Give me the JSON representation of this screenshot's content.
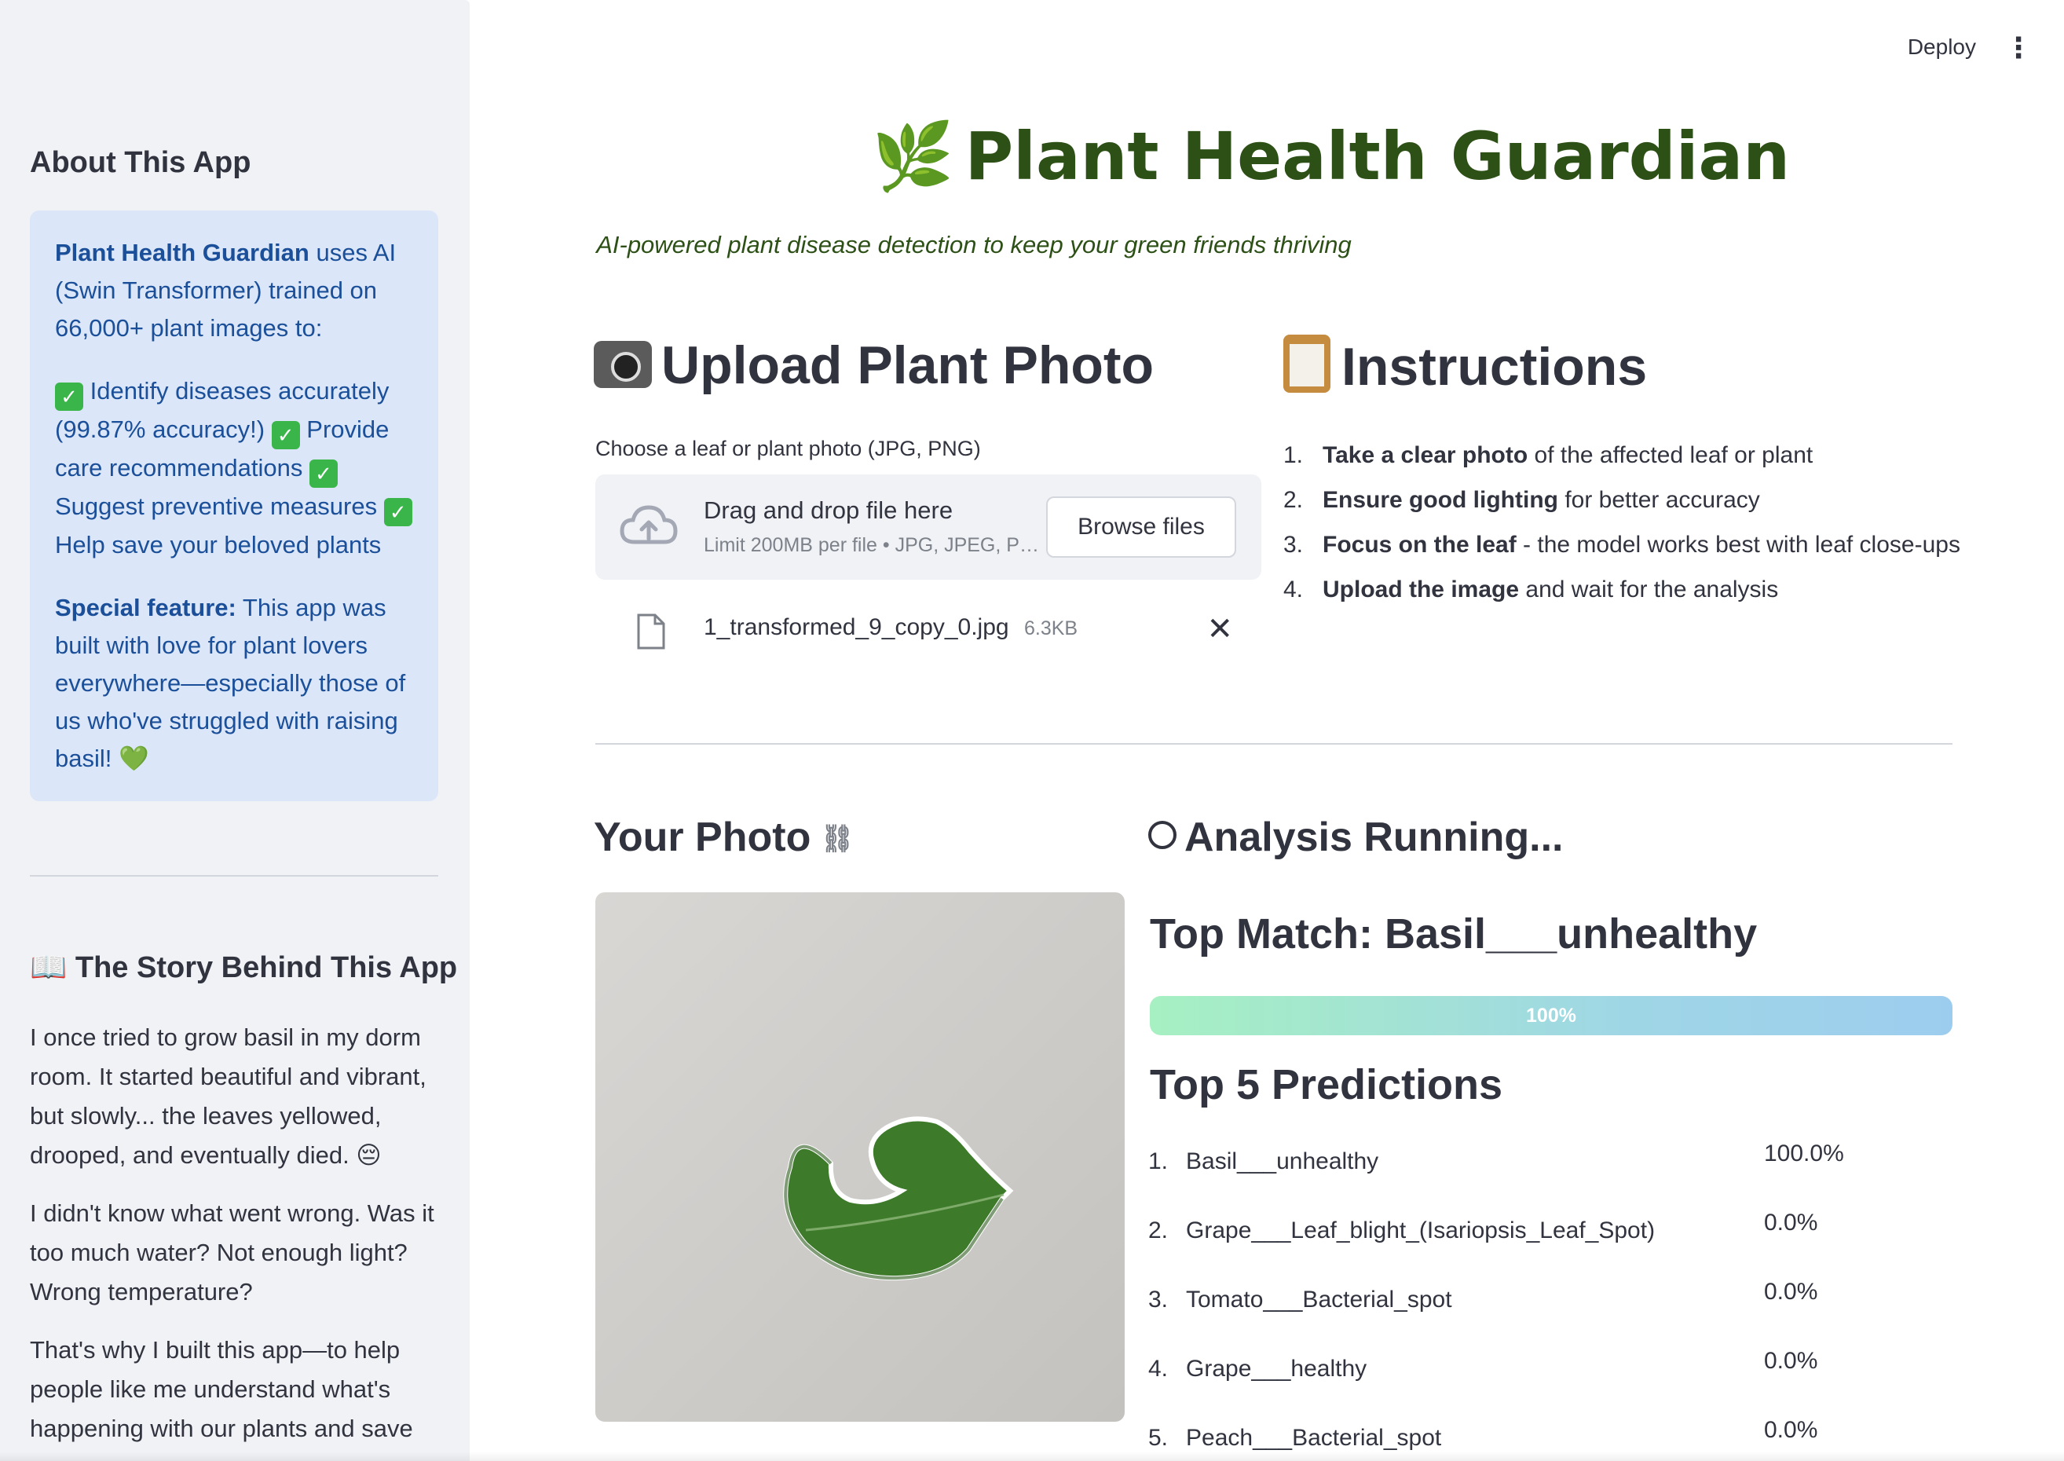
{
  "header": {
    "deploy_label": "Deploy",
    "menu_icon": "⋮"
  },
  "sidebar": {
    "about_heading": "About This App",
    "info": {
      "intro_bold": "Plant Health Guardian",
      "intro_rest": " uses AI (Swin Transformer) trained on 66,000+ plant images to:",
      "features_text_1": " Identify diseases accurately (99.87% accuracy!) ",
      "features_text_2": " Provide care recommendations ",
      "features_text_3": " Suggest preventive measures ",
      "features_text_4": " Help save your beloved plants",
      "special_bold": "Special feature:",
      "special_rest": " This app was built with love for plant lovers everywhere—especially those of us who've struggled with raising basil! 💚"
    },
    "story_heading": "📖 The Story Behind This App",
    "story_paragraphs": [
      "I once tried to grow basil in my dorm room. It started beautiful and vibrant, but slowly... the leaves yellowed, drooped, and eventually died. 😔",
      "I didn't know what went wrong. Was it too much water? Not enough light? Wrong temperature?",
      "That's why I built this app—to help people like me understand what's happening with our plants and save"
    ]
  },
  "main": {
    "title": "Plant Health Guardian",
    "title_icon": "🌿",
    "subtitle": "AI-powered plant disease detection to keep your green friends thriving",
    "upload": {
      "heading": "Upload Plant Photo",
      "label": "Choose a leaf or plant photo (JPG, PNG)",
      "drop_title": "Drag and drop file here",
      "drop_sub": "Limit 200MB per file • JPG, JPEG, P…",
      "browse_label": "Browse files",
      "file_name": "1_transformed_9_copy_0.jpg",
      "file_size": "6.3KB",
      "close_icon": "✕"
    },
    "instructions": {
      "heading": "Instructions",
      "items": [
        {
          "num": "1.",
          "bold": "Take a clear photo",
          "rest": " of the affected leaf or plant"
        },
        {
          "num": "2.",
          "bold": "Ensure good lighting",
          "rest": " for better accuracy"
        },
        {
          "num": "3.",
          "bold": "Focus on the leaf",
          "rest": " - the model works best with leaf close-ups"
        },
        {
          "num": "4.",
          "bold": "Upload the image",
          "rest": " and wait for the analysis"
        }
      ]
    },
    "photo_heading": "Your Photo",
    "analysis": {
      "heading": "Analysis Running...",
      "top_match": "Top Match: Basil___unhealthy",
      "progress_label": "100%",
      "progress_value": 1.0,
      "top5_heading": "Top 5 Predictions",
      "predictions": [
        {
          "num": "1.",
          "name": "Basil___unhealthy",
          "value": "100.0%"
        },
        {
          "num": "2.",
          "name": "Grape___Leaf_blight_(Isariopsis_Leaf_Spot)",
          "value": "0.0%"
        },
        {
          "num": "3.",
          "name": "Tomato___Bacterial_spot",
          "value": "0.0%"
        },
        {
          "num": "4.",
          "name": "Grape___healthy",
          "value": "0.0%"
        },
        {
          "num": "5.",
          "name": "Peach___Bacterial_spot",
          "value": "0.0%"
        }
      ]
    }
  },
  "colors": {
    "title": "#2d5016",
    "info_bg": "#dbe7f8",
    "info_text": "#1b4f99",
    "sidebar_bg": "#f0f2f6"
  }
}
